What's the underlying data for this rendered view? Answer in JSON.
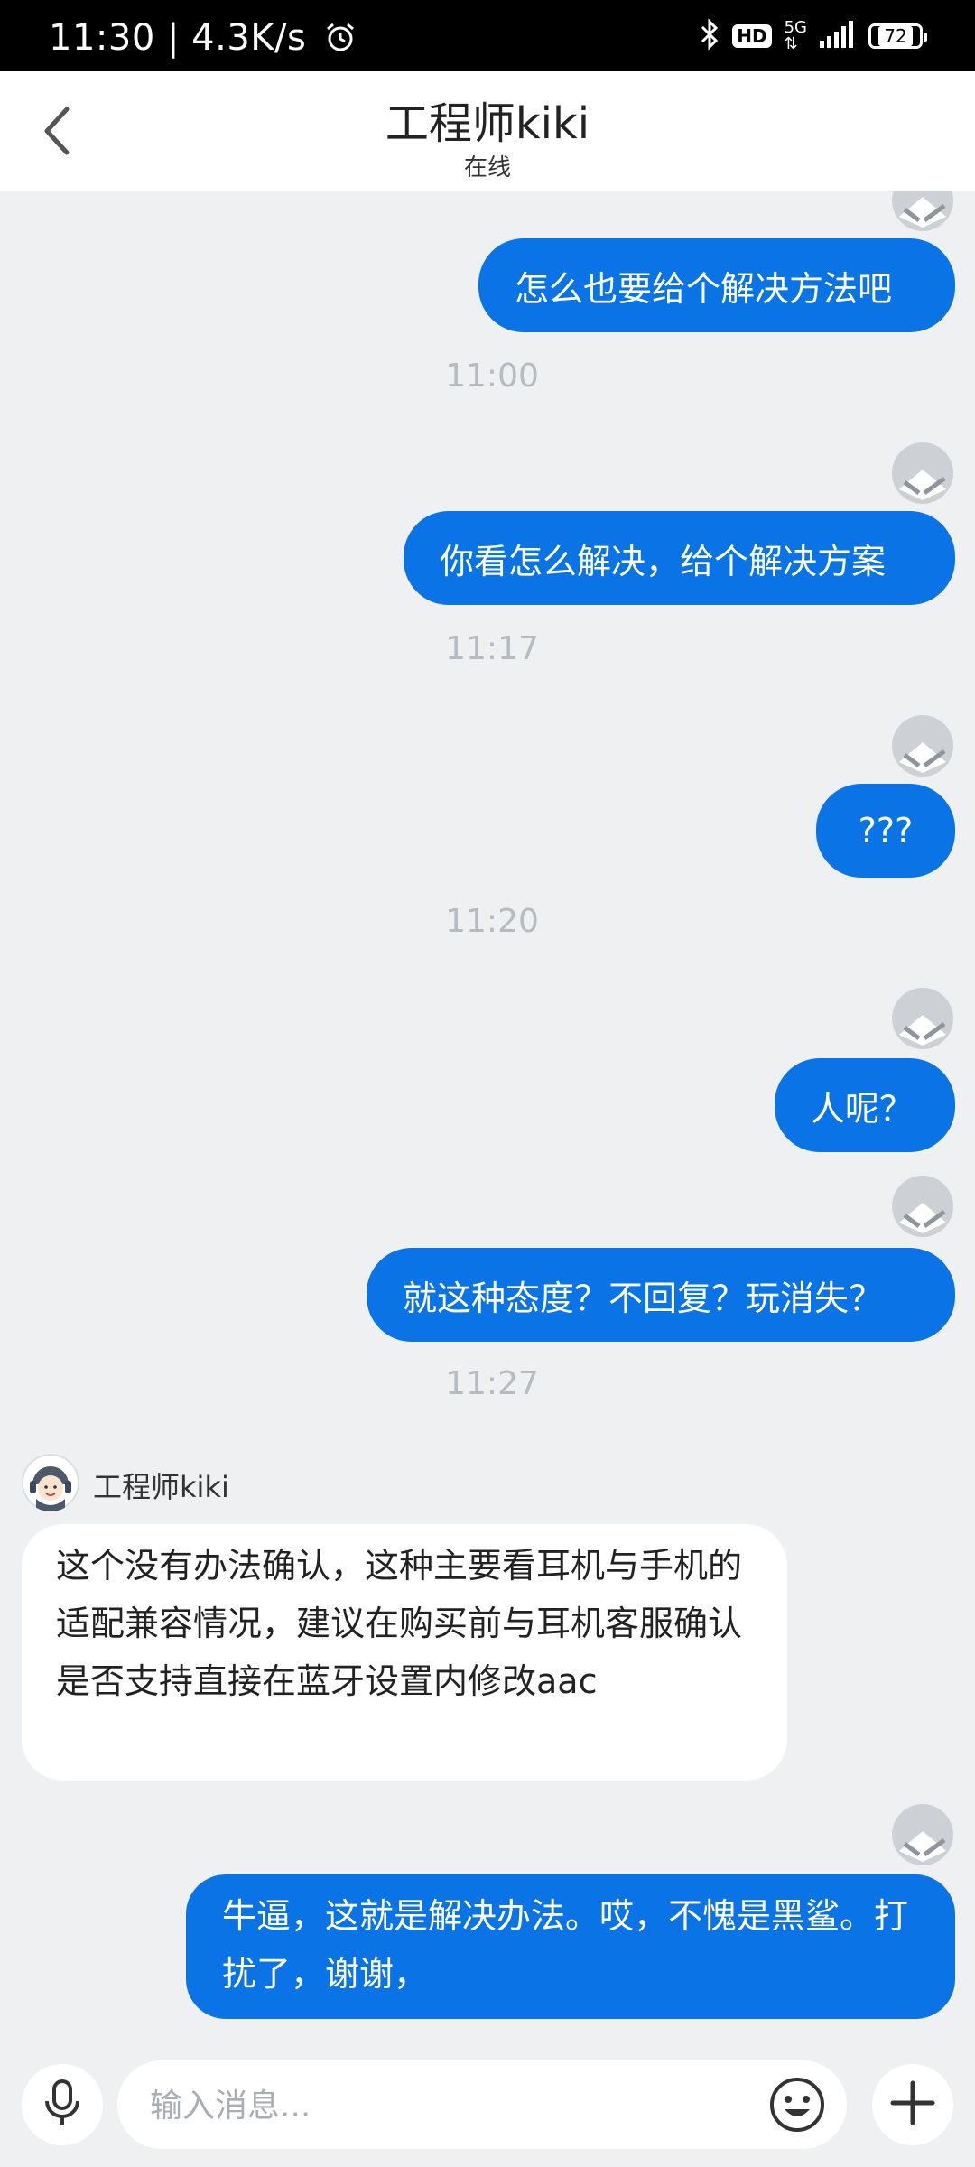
{
  "status_bar": {
    "time_speed": "11:30 | 4.3K/s",
    "hd": "HD",
    "network": "5G",
    "battery": "72"
  },
  "header": {
    "title": "工程师kiki",
    "subtitle": "在线"
  },
  "messages": [
    {
      "type": "out",
      "text": "怎么也要给个解决方法吧"
    },
    {
      "type": "time",
      "text": "11:00"
    },
    {
      "type": "out",
      "text": "你看怎么解决，给个解决方案"
    },
    {
      "type": "time",
      "text": "11:17"
    },
    {
      "type": "out",
      "text": "???"
    },
    {
      "type": "time",
      "text": "11:20"
    },
    {
      "type": "out",
      "text": "人呢？"
    },
    {
      "type": "out",
      "text": "就这种态度？不回复？玩消失？"
    },
    {
      "type": "time",
      "text": "11:27"
    },
    {
      "type": "in",
      "sender": "工程师kiki",
      "text": "这个没有办法确认，这种主要看耳机与手机的适配兼容情况，建议在购买前与耳机客服确认是否支持直接在蓝牙设置内修改aac"
    },
    {
      "type": "out",
      "text": "牛逼，这就是解决办法。哎，不愧是黑鲨。打扰了，谢谢，"
    }
  ],
  "input": {
    "placeholder": "输入消息..."
  },
  "icons": {
    "back": "chevron-left-icon",
    "alarm": "alarm-icon",
    "bluetooth": "bluetooth-icon",
    "mic": "microphone-icon",
    "emoji": "smiley-icon",
    "plus": "plus-icon"
  },
  "colors": {
    "outgoing_bubble": "#0A73E6",
    "chat_background": "#EEF0F1",
    "timestamp": "#B4BBC2"
  }
}
